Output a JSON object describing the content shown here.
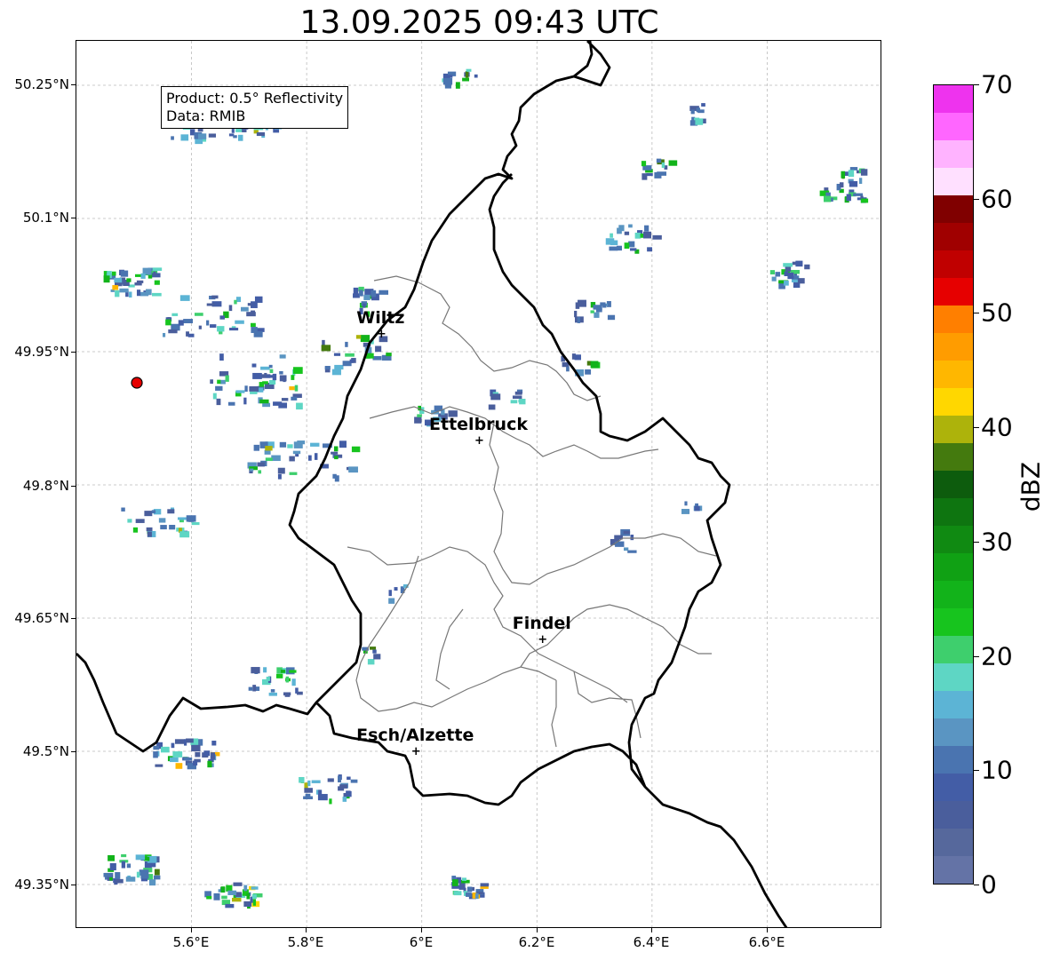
{
  "title": "13.09.2025 09:43 UTC",
  "info": {
    "product": "Product: 0.5° Reflectivity",
    "data": "Data: RMIB"
  },
  "y_axis_labels": [
    "50.25°N",
    "50.1°N",
    "49.95°N",
    "49.8°N",
    "49.65°N",
    "49.5°N",
    "49.35°N"
  ],
  "x_axis_labels": [
    "5.6°E",
    "5.8°E",
    "6°E",
    "6.2°E",
    "6.4°E",
    "6.6°E"
  ],
  "cities": [
    {
      "name": "Wiltz",
      "lat": 49.97,
      "lon": 5.93
    },
    {
      "name": "Ettelbruck",
      "lat": 49.85,
      "lon": 6.1
    },
    {
      "name": "Findel",
      "lat": 49.626,
      "lon": 6.21
    },
    {
      "name": "Esch/Alzette",
      "lat": 49.5,
      "lon": 5.99
    }
  ],
  "radar_site": {
    "lat": 49.915,
    "lon": 5.505,
    "color": "#e60000"
  },
  "extent": {
    "lon_min": 5.4,
    "lon_max": 6.8,
    "lat_min": 49.3,
    "lat_max": 50.3
  },
  "colorbar": {
    "label": "dBZ",
    "min": 0,
    "max": 70,
    "tick_labels": [
      "0",
      "10",
      "20",
      "30",
      "40",
      "50",
      "60",
      "70"
    ],
    "colors": [
      "#6473a6",
      "#56689c",
      "#4a5e9c",
      "#435da6",
      "#4a74b0",
      "#5a95c2",
      "#5cb4d5",
      "#5ed6c4",
      "#3ecf6d",
      "#17c41e",
      "#12b31a",
      "#10a114",
      "#108a12",
      "#0e7510",
      "#0d5c0d",
      "#447a0e",
      "#adb30b",
      "#ffd700",
      "#ffb700",
      "#ff9c00",
      "#ff7f00",
      "#e60000",
      "#c00000",
      "#a00000",
      "#800000",
      "#ffe0ff",
      "#ffb3ff",
      "#ff66ff",
      "#ee33ee"
    ]
  }
}
